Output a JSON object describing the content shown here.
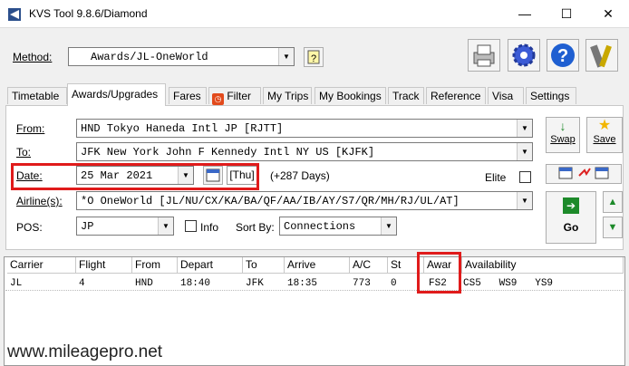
{
  "window": {
    "title": "KVS Tool 9.8.6/Diamond",
    "minimize": "—",
    "maximize": "☐",
    "close": "✕"
  },
  "method": {
    "label": "Method:",
    "value": "Awards/JL-OneWorld"
  },
  "tabs": [
    {
      "label": "Timetable"
    },
    {
      "label": "Awards/Upgrades"
    },
    {
      "label": "Fares"
    },
    {
      "label": "Filter"
    },
    {
      "label": "My Trips"
    },
    {
      "label": "My Bookings"
    },
    {
      "label": "Track"
    },
    {
      "label": "Reference"
    },
    {
      "label": "Visa"
    },
    {
      "label": "Settings"
    }
  ],
  "form": {
    "from_label": "From:",
    "from_value": "HND  Tokyo Haneda Intl JP [RJTT]",
    "to_label": "To:",
    "to_value": "JFK  New York John F Kennedy Intl NY US [KJFK]",
    "date_label": "Date:",
    "date_value": "25 Mar 2021",
    "day": "[Thu]",
    "days_out": "(+287 Days)",
    "elite_label": "Elite",
    "airlines_label": "Airline(s):",
    "airlines_value": "*O  OneWorld [JL/NU/CX/KA/BA/QF/AA/IB/AY/S7/QR/MH/RJ/UL/AT]",
    "pos_label": "POS:",
    "pos_value": "JP",
    "info_label": "Info",
    "sortby_label": "Sort By:",
    "sortby_value": "Connections"
  },
  "buttons": {
    "swap": "Swap",
    "save": "Save",
    "go": "Go"
  },
  "grid": {
    "headers": [
      "Carrier",
      "Flight",
      "From",
      "Depart",
      "To",
      "Arrive",
      "A/C",
      "St",
      "Awar",
      "Availability"
    ],
    "rows": [
      [
        "JL",
        "4",
        "HND",
        "18:40",
        "JFK",
        "18:35",
        "773",
        "0",
        "FS2",
        "CS5   WS9   YS9"
      ]
    ]
  },
  "watermark": "www.mileagepro.net",
  "colors": {
    "highlight": "#e01b1b",
    "go_green": "#1d8a2a"
  }
}
